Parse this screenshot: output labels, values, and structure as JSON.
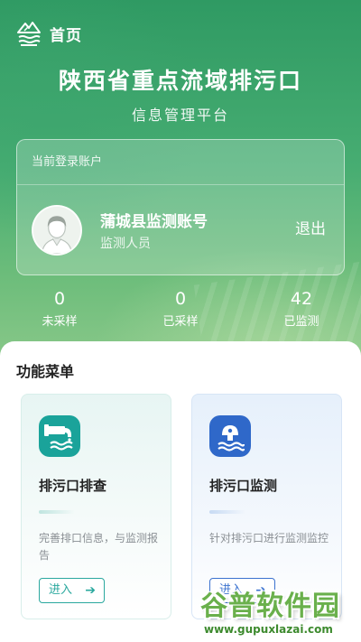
{
  "header": {
    "home_label": "首页",
    "title": "陕西省重点流域排污口",
    "subtitle": "信息管理平台"
  },
  "account": {
    "heading": "当前登录账户",
    "name": "蒲城县监测账号",
    "role": "监测人员",
    "logout_label": "退出"
  },
  "stats": [
    {
      "value": "0",
      "label": "未采样"
    },
    {
      "value": "0",
      "label": "已采样"
    },
    {
      "value": "42",
      "label": "已监测"
    }
  ],
  "menu": {
    "title": "功能菜单",
    "cards": [
      {
        "title": "排污口排查",
        "description": "完善排口信息，与监测报告",
        "enter_label": "进入",
        "icon": "drain-pipe-icon",
        "color": "#1aa39a"
      },
      {
        "title": "排污口监测",
        "description": "针对排污口进行监测监控",
        "enter_label": "进入",
        "icon": "water-monitor-icon",
        "color": "#2f68c9"
      }
    ]
  },
  "watermark": {
    "main": "谷普软件园",
    "url": "www.gupuxlazai.com"
  },
  "colors": {
    "hero_green": "#3fa86c",
    "teal": "#1aa39a",
    "blue": "#2f68c9"
  }
}
